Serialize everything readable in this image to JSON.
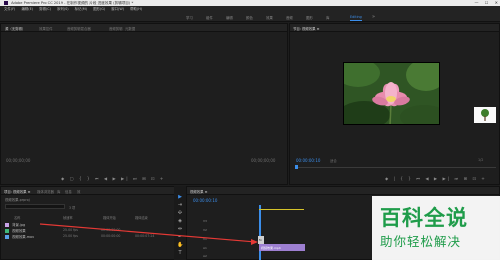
{
  "titlebar": {
    "text": "Adobe Premiere Pro CC 2019 - 在制作视频的 片段 进度效果 (剪辑项目) *",
    "minimize": "—",
    "maximize": "☐",
    "close": "✕"
  },
  "menubar": [
    "文件(F)",
    "编辑(E)",
    "剪辑(C)",
    "序列(S)",
    "标记(M)",
    "图形(G)",
    "窗口(W)",
    "帮助(H)"
  ],
  "workspaces": [
    {
      "label": "学习",
      "active": false
    },
    {
      "label": "组件",
      "active": false
    },
    {
      "label": "编辑",
      "active": false
    },
    {
      "label": "颜色",
      "active": false
    },
    {
      "label": "效果",
      "active": false
    },
    {
      "label": "音频",
      "active": false
    },
    {
      "label": "图形",
      "active": false
    },
    {
      "label": "库",
      "active": false
    },
    {
      "label": "Editing",
      "active": true
    }
  ],
  "workspace_more": "»",
  "source_panel": {
    "tabs": [
      "源（无剪辑）",
      "效果控件",
      "音频剪辑混合器",
      "音频剪辑",
      "元数据"
    ],
    "timecode_left": "00;00;00;00",
    "timecode_right": "00;00;00;00",
    "transport": "◆ ▢ { } ⏮ ◀ ▶ ▶| ⏭ ⊞ ⊡ +"
  },
  "program_panel": {
    "tab": "节目: 视频效果 ≡",
    "timecode": "00:00:00:10",
    "fit": "适合",
    "ratio": "1/2",
    "transport": "◆ | { } ⏮ ◀ ▶ ▶| ⏭ ⊞ ⊡ +"
  },
  "project_panel": {
    "tabs": [
      "项目: 视频效果 ≡",
      "媒体浏览器",
      "库",
      "信息",
      "效"
    ],
    "project_file": "视频效果.prproj",
    "item_count": "3 项",
    "columns": [
      "名称",
      "帧速率",
      "媒体开始",
      "媒体结束"
    ],
    "items": [
      {
        "name": "背景.jpg",
        "color": "#c8a2e8",
        "rate": "",
        "start": "",
        "end": ""
      },
      {
        "name": "视频效果",
        "color": "#3fb77a",
        "rate": "25.00 fps",
        "start": "00:00:00:00",
        "end": ""
      },
      {
        "name": "视频效果.mov",
        "color": "#5aa0e8",
        "rate": "25.00 fps",
        "start": "00:00:00:00",
        "end": "00:00:07:24"
      }
    ]
  },
  "timeline_panel": {
    "tab": "视频效果 ≡",
    "timecode": "00:00:00:10",
    "tracks": [
      "V3",
      "V2",
      "V1",
      "A1",
      "A2"
    ],
    "clip_v1": "视频效果.mp4",
    "clip_v2": "fx"
  },
  "watermark": {
    "title": "百科全说",
    "subtitle": "助你轻松解决"
  },
  "colors": {
    "accent": "#3b8eea",
    "clip_purple": "#9d7fd1",
    "arrow_red": "#e53935",
    "watermark_green": "#1f9c4a"
  }
}
